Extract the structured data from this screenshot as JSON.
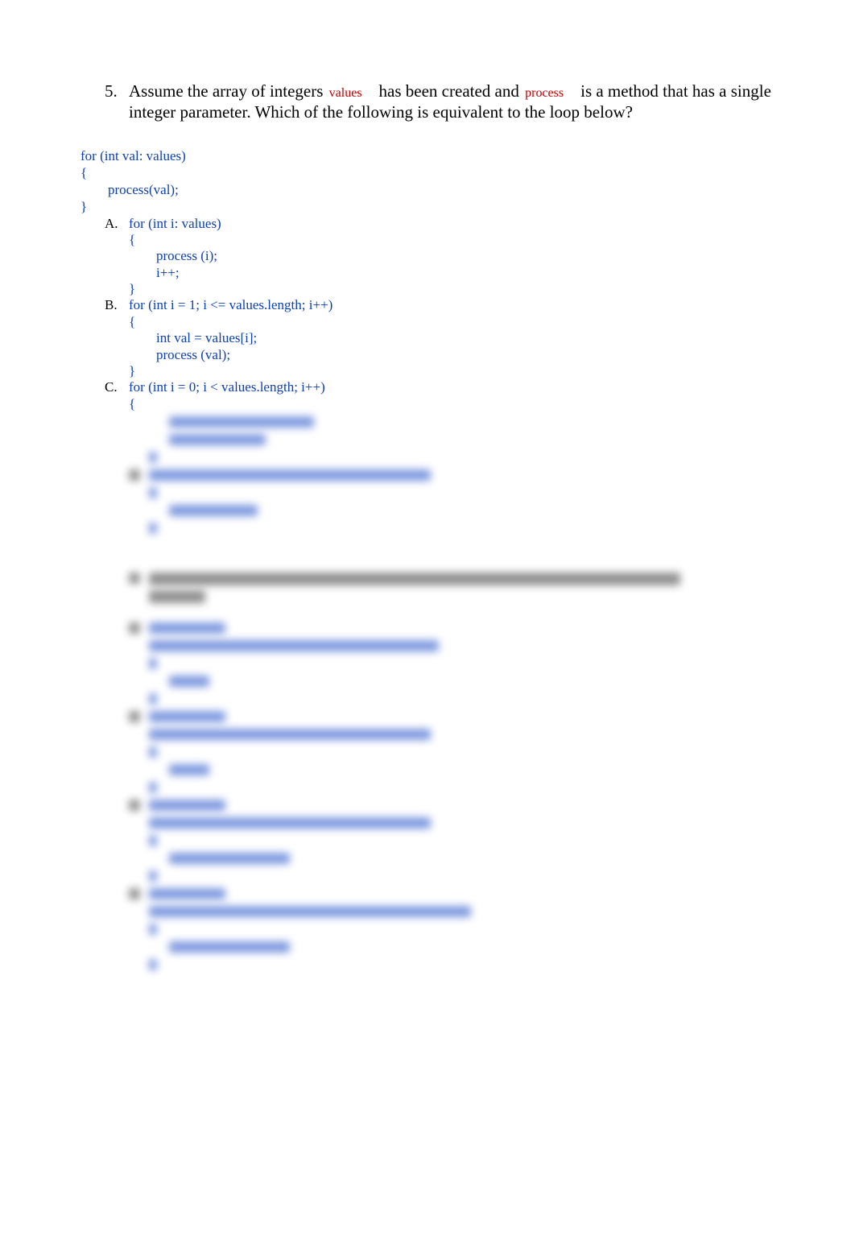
{
  "question5": {
    "number": "5.",
    "text_before_values": "Assume the array of integers ",
    "code_values": "values",
    "text_mid": " has been created and ",
    "code_process": "process",
    "text_after": " is a method that has a single integer parameter. Which of the following is equivalent to the loop below?"
  },
  "code_block": "for (int val: values)\n{\n        process(val);\n}",
  "options": {
    "A": {
      "label": "A.",
      "code": "for (int i: values)\n{\n        process (i);\n        i++;\n}"
    },
    "B": {
      "label": "B.",
      "code": "for (int i = 1; i <= values.length; i++)\n{\n        int val = values[i];\n        process (val);\n}"
    },
    "C": {
      "label": "C.",
      "code": "for (int i = 0; i < values.length; i++)\n{"
    }
  }
}
